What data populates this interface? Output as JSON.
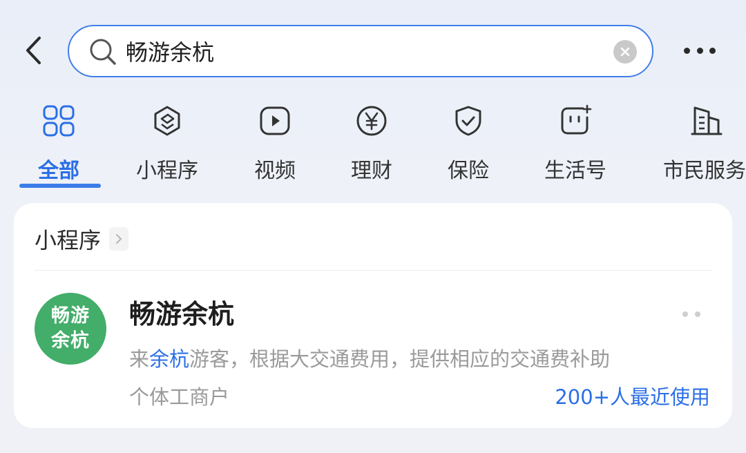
{
  "search": {
    "query": "畅游余杭",
    "placeholder": ""
  },
  "tabs": [
    {
      "label": "全部",
      "icon": "grid-icon",
      "active": true
    },
    {
      "label": "小程序",
      "icon": "mini-program-icon",
      "active": false
    },
    {
      "label": "视频",
      "icon": "video-play-icon",
      "active": false
    },
    {
      "label": "理财",
      "icon": "yen-icon",
      "active": false
    },
    {
      "label": "保险",
      "icon": "shield-icon",
      "active": false
    },
    {
      "label": "生活号",
      "icon": "life-account-icon",
      "active": false
    },
    {
      "label": "市民服务",
      "icon": "building-icon",
      "active": false
    }
  ],
  "section": {
    "title": "小程序"
  },
  "result": {
    "logo_line1": "畅游",
    "logo_line2": "余杭",
    "name": "畅游余杭",
    "desc_prefix": "来",
    "desc_highlight": "余杭",
    "desc_suffix": "游客，根据大交通费用，提供相应的交通费补助",
    "merchant": "个体工商户",
    "usage": "200+人最近使用"
  },
  "colors": {
    "accent": "#2b6fe6",
    "logo_green": "#43ad6a",
    "muted_text": "#9a9a9a"
  }
}
